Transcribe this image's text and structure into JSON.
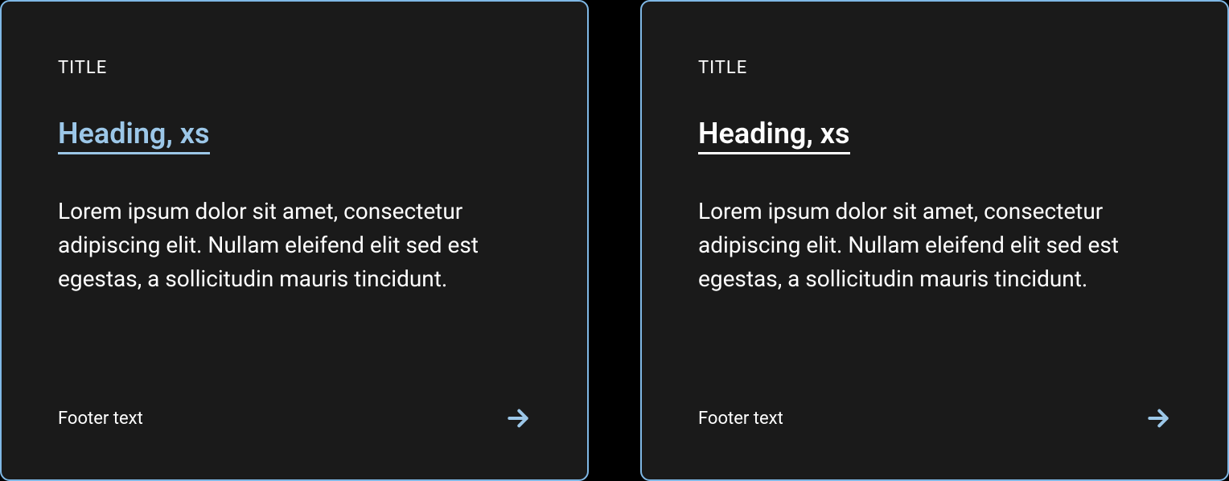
{
  "cards": [
    {
      "title": "TITLE",
      "heading": "Heading, xs",
      "heading_color": "accent",
      "description": "Lorem ipsum dolor sit amet, consectetur adipiscing elit. Nullam eleifend elit sed est egestas, a sollicitudin mauris tincidunt.",
      "footer_text": "Footer text"
    },
    {
      "title": "TITLE",
      "heading": "Heading, xs",
      "heading_color": "white",
      "description": "Lorem ipsum dolor sit amet, consectetur adipiscing elit. Nullam eleifend elit sed est egestas, a sollicitudin mauris tincidunt.",
      "footer_text": "Footer text"
    }
  ],
  "colors": {
    "accent": "#9cc7e8",
    "card_bg": "#1a1a1a",
    "border": "#7fb8e6",
    "text": "#ffffff"
  }
}
